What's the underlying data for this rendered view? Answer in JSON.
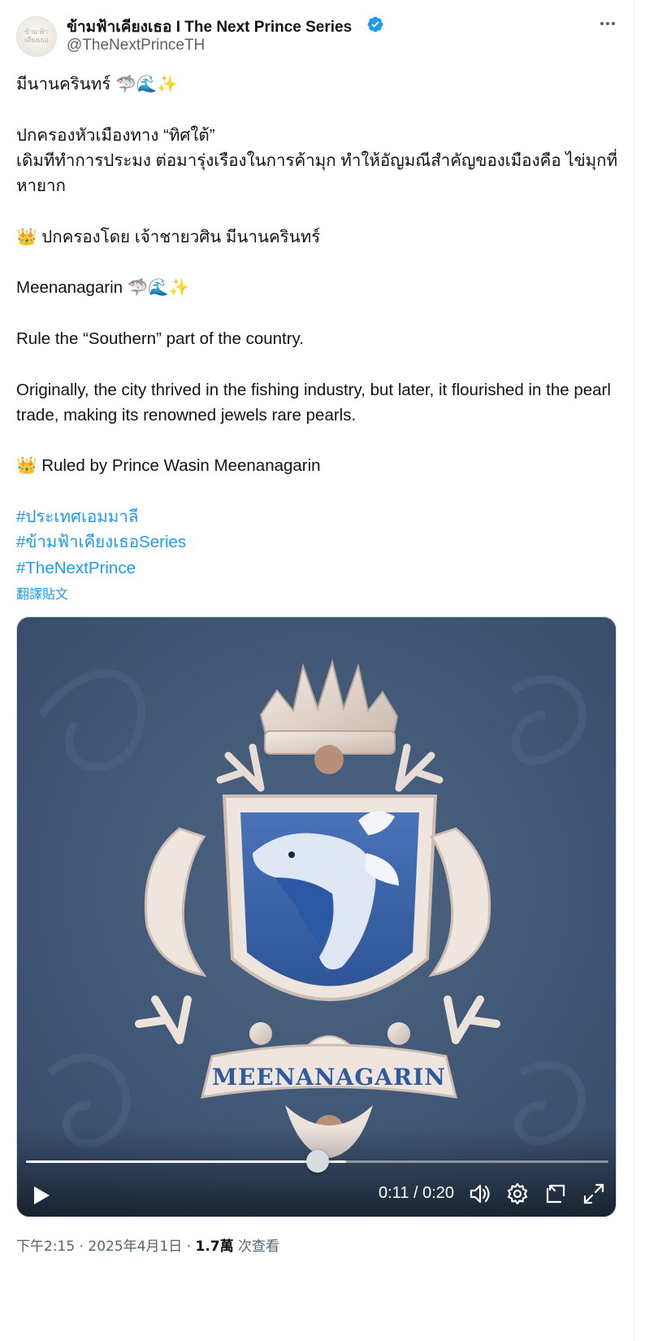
{
  "author": {
    "display_name": "ข้ามฟ้าเคียงเธอ I The Next Prince Series",
    "handle": "@TheNextPrinceTH",
    "avatar_icon": "avatar-logo",
    "verified": true,
    "verified_color": "#1d9bf0"
  },
  "post": {
    "lines": [
      "มีนานครินทร์ 🦈🌊✨",
      "",
      "ปกครองหัวเมืองทาง “ทิศใต้”",
      "เดิมทีทำการประมง ต่อมารุ่งเรืองในการค้ามุก ทำให้อัญมณีสำคัญของเมืองคือ ไข่มุกที่หายาก",
      "",
      "👑 ปกครองโดย เจ้าชายวศิน มีนานครินทร์",
      "",
      "Meenanagarin 🦈🌊✨",
      "",
      "Rule the “Southern” part of the country.",
      "",
      "Originally, the city thrived in the fishing industry, but later, it flourished in the pearl trade, making its renowned jewels rare pearls.",
      "",
      "👑 Ruled by Prince Wasin Meenanagarin",
      ""
    ],
    "hashtags": [
      "#ประเทศเอมมาลี",
      "#ข้ามฟ้าเคียงเธอSeries",
      "#TheNextPrince"
    ],
    "translate_label": "翻譯貼文",
    "link_color": "#1d9bf0"
  },
  "video": {
    "banner_text": "MEENANAGARIN",
    "current_time": "0:11",
    "duration": "0:20",
    "time_display": "0:11 / 0:20",
    "progress_fraction": 0.55,
    "knob_fraction": 0.5,
    "background_color": "#3f5674",
    "controls": {
      "play": "play-icon",
      "volume": "volume-icon",
      "settings": "gear-icon",
      "dock": "dock-icon",
      "fullscreen": "fullscreen-icon"
    }
  },
  "meta": {
    "time": "下午2:15",
    "separator": " · ",
    "date": "2025年4月1日",
    "views_count": "1.7萬",
    "views_label": " 次查看"
  }
}
